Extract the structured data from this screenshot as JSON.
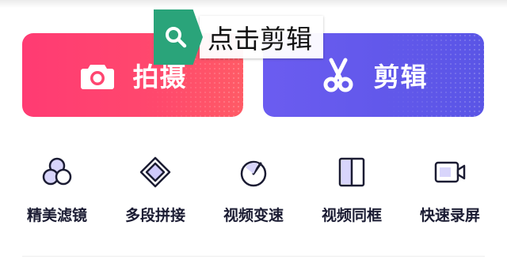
{
  "tooltip": {
    "text": "点击剪辑",
    "icon": "search-icon",
    "color": "#2aa47a"
  },
  "primary_actions": [
    {
      "label": "拍摄",
      "icon": "camera-icon",
      "color": "#ff4570"
    },
    {
      "label": "剪辑",
      "icon": "scissors-icon",
      "color": "#5f58ea"
    }
  ],
  "tools": [
    {
      "label": "精美滤镜",
      "icon": "filter-icon"
    },
    {
      "label": "多段拼接",
      "icon": "splice-icon"
    },
    {
      "label": "视频变速",
      "icon": "speed-icon"
    },
    {
      "label": "视频同框",
      "icon": "split-screen-icon"
    },
    {
      "label": "快速录屏",
      "icon": "screen-record-icon"
    }
  ]
}
